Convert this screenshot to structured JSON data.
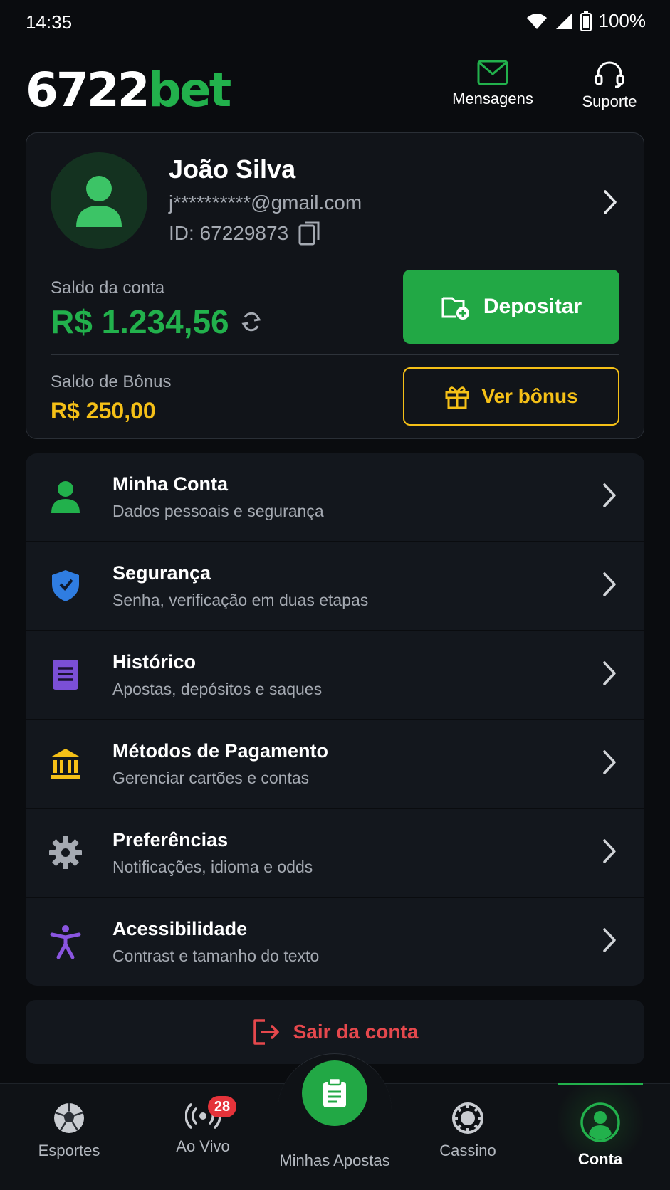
{
  "status_bar": {
    "time": "14:35",
    "battery": "100%"
  },
  "header": {
    "logo_num": "6722",
    "logo_bet": "bet",
    "messages_label": "Mensagens",
    "support_label": "Suporte"
  },
  "profile": {
    "name": "João Silva",
    "email": "j**********@gmail.com",
    "id_text": "ID: 67229873",
    "balance_label": "Saldo da conta",
    "balance_value": "R$ 1.234,56",
    "deposit_label": "Depositar",
    "bonus_label": "Saldo de Bônus",
    "bonus_value": "R$ 250,00",
    "bonus_button_label": "Ver bônus"
  },
  "menu": {
    "items": [
      {
        "title": "Minha Conta",
        "subtitle": "Dados pessoais e segurança",
        "icon": "person-icon"
      },
      {
        "title": "Segurança",
        "subtitle": "Senha, verificação em duas etapas",
        "icon": "shield-icon"
      },
      {
        "title": "Histórico",
        "subtitle": "Apostas, depósitos e saques",
        "icon": "document-icon"
      },
      {
        "title": "Métodos de Pagamento",
        "subtitle": "Gerenciar cartões e contas",
        "icon": "bank-icon"
      },
      {
        "title": "Preferências",
        "subtitle": "Notificações, idioma e odds",
        "icon": "gear-icon"
      },
      {
        "title": "Acessibilidade",
        "subtitle": "Contrast e tamanho do texto",
        "icon": "accessibility-icon"
      }
    ]
  },
  "logout_label": "Sair da conta",
  "bottom_nav": {
    "items": [
      {
        "label": "Esportes",
        "icon": "soccer-ball-icon"
      },
      {
        "label": "Ao Vivo",
        "icon": "live-icon",
        "badge": "28"
      },
      {
        "label": "Minhas Apostas",
        "icon": "clipboard-icon"
      },
      {
        "label": "Cassino",
        "icon": "chip-icon"
      },
      {
        "label": "Conta",
        "icon": "account-icon",
        "active": true
      }
    ]
  },
  "colors": {
    "background": "#0a0c0f",
    "card": "#13171d",
    "brand_green": "#22b14c",
    "bonus_yellow": "#f5c017",
    "danger_red": "#e5484d"
  }
}
